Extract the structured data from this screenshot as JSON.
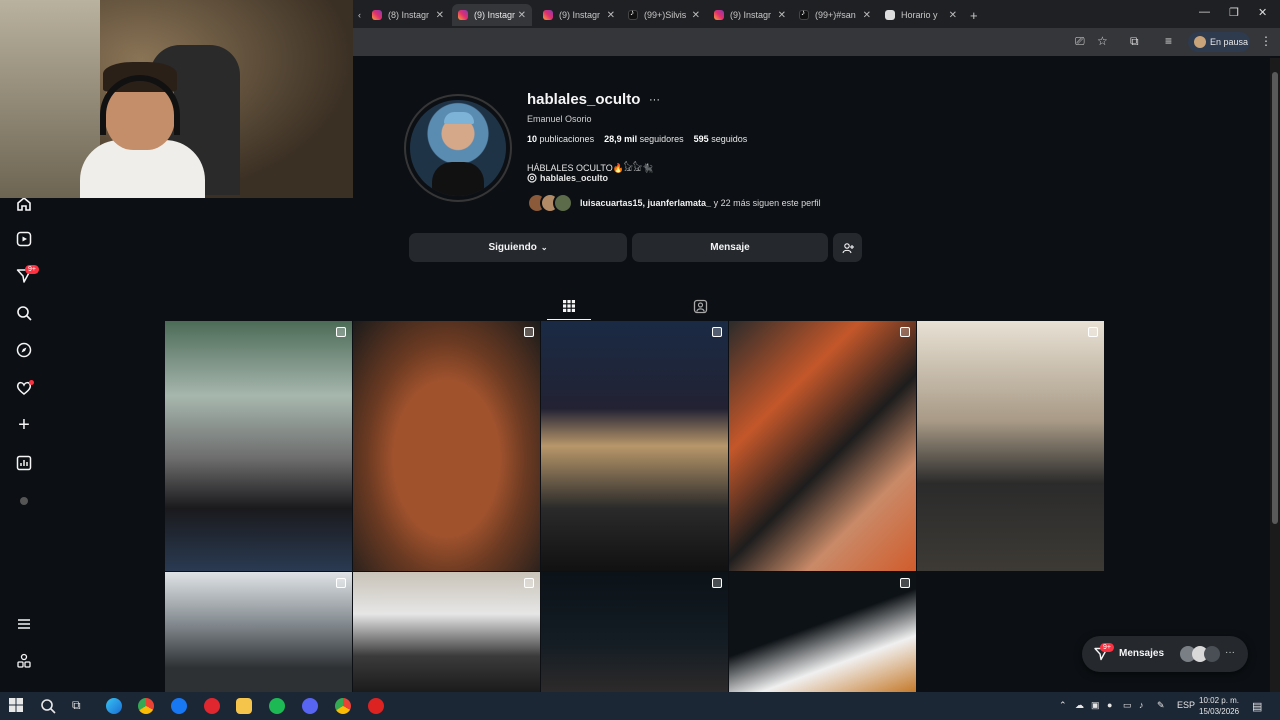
{
  "browser": {
    "tabs": [
      {
        "label": "(8) Instagr",
        "icon": "instagram-icon"
      },
      {
        "label": "(9) Instagr",
        "icon": "instagram-icon",
        "active": true
      },
      {
        "label": "(9) Instagr",
        "icon": "instagram-icon"
      },
      {
        "label": "(99+)Silvis",
        "icon": "tiktok-icon"
      },
      {
        "label": "(9) Instagr",
        "icon": "instagram-icon"
      },
      {
        "label": "(99+)#san",
        "icon": "tiktok-icon"
      },
      {
        "label": "Horario y",
        "icon": "horario-icon"
      }
    ],
    "new_tab": "+",
    "profile_status": "En pausa"
  },
  "profile": {
    "username": "hablales_oculto",
    "more": "···",
    "full_name": "Emanuel Osorio",
    "stats": {
      "posts_count": "10",
      "posts_label": "publicaciones",
      "followers_count": "28,9 mil",
      "followers_label": "seguidores",
      "following_count": "595",
      "following_label": "seguidos"
    },
    "bio": "HÁBLALES OCULTO🔥𓃠𓃠🐈‍⬛",
    "threads_handle": "hablales_oculto",
    "followed_by": {
      "names": "luisacuartas15, juanferlamata_",
      "rest": " y 22 más siguen este perfil"
    }
  },
  "actions": {
    "following_label": "Siguiendo",
    "message_label": "Mensaje"
  },
  "nav": {
    "notifications_badge": "9+"
  },
  "messages": {
    "label": "Mensajes",
    "badge": "9+"
  },
  "taskbar": {
    "language": "ESP",
    "time": "10:02 p. m.",
    "date": "15/03/2026"
  },
  "colors": {
    "background": "#0c1014",
    "button": "#25292e",
    "badge": "#ff3040"
  }
}
